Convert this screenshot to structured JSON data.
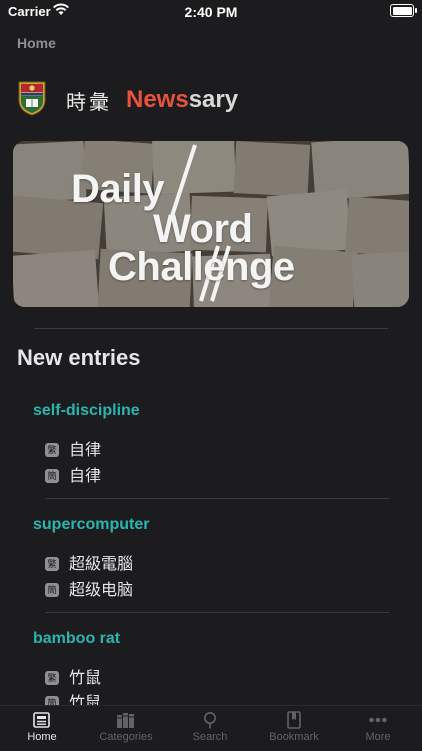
{
  "status_bar": {
    "carrier": "Carrier",
    "time": "2:40 PM"
  },
  "nav": {
    "title": "Home"
  },
  "brand": {
    "cjk": "時彙",
    "name_accent": "News",
    "name_rest": "sary"
  },
  "banner": {
    "line1": "Daily",
    "line2": "Word",
    "line3": "Challenge"
  },
  "section": {
    "title": "New entries"
  },
  "entries": [
    {
      "word": "self-discipline",
      "badge_trad": "繁",
      "trad": "自律",
      "badge_simp": "簡",
      "simp": "自律"
    },
    {
      "word": "supercomputer",
      "badge_trad": "繁",
      "trad": "超級電腦",
      "badge_simp": "簡",
      "simp": "超级电脑"
    },
    {
      "word": "bamboo rat",
      "badge_trad": "繁",
      "trad": "竹鼠",
      "badge_simp": "簡",
      "simp": "竹鼠"
    }
  ],
  "tabs": [
    {
      "label": "Home",
      "icon": "newspaper-icon",
      "active": true
    },
    {
      "label": "Categories",
      "icon": "books-icon",
      "active": false
    },
    {
      "label": "Search",
      "icon": "search-icon",
      "active": false
    },
    {
      "label": "Bookmark",
      "icon": "bookmark-icon",
      "active": false
    },
    {
      "label": "More",
      "icon": "more-icon",
      "active": false
    }
  ],
  "colors": {
    "background": "#1c1c1e",
    "accent_red": "#e8533e",
    "accent_teal": "#2ab5b0",
    "tab_inactive": "#636366"
  }
}
